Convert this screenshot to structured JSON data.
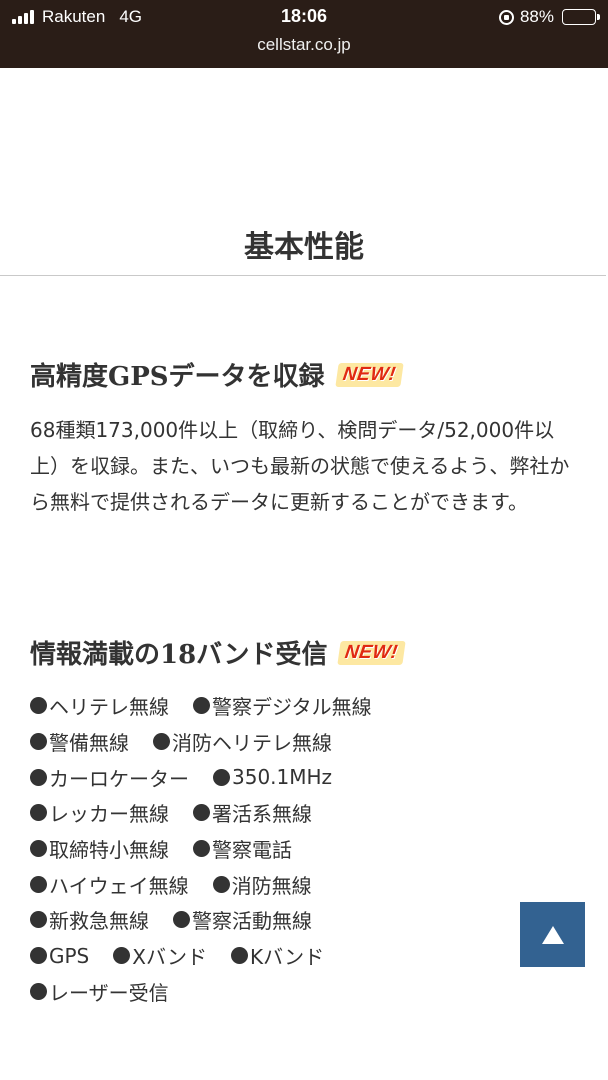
{
  "status_bar": {
    "carrier": "Rakuten",
    "network": "4G",
    "time": "18:06",
    "battery": "88%",
    "battery_level": 0.88,
    "url": "cellstar.co.jp"
  },
  "section": {
    "title": "基本性能"
  },
  "features": [
    {
      "heading": "高精度GPSデータを収録",
      "badge": "NEW!",
      "body": "68種類173,000件以上（取締り、検問データ/52,000件以上）を収録。また、いつも最新の状態で使えるよう、弊社から無料で提供されるデータに更新することができます。"
    },
    {
      "heading": "情報満載の18バンド受信",
      "badge": "NEW!",
      "bands": [
        [
          "ヘリテレ無線",
          "警察デジタル無線"
        ],
        [
          "警備無線",
          "消防ヘリテレ無線"
        ],
        [
          "カーロケーター",
          "350.1MHz"
        ],
        [
          "レッカー無線",
          "署活系無線"
        ],
        [
          "取締特小無線",
          "警察電話"
        ],
        [
          "ハイウェイ無線",
          "消防無線"
        ],
        [
          "新救急無線",
          "警察活動無線"
        ],
        [
          "GPS",
          "Xバンド",
          "Kバンド"
        ],
        [
          "レーザー受信"
        ]
      ]
    }
  ],
  "colors": {
    "status_bar_bg": "#2a1d17",
    "badge_red": "#e02a12",
    "scroll_top_button": "#336291"
  }
}
